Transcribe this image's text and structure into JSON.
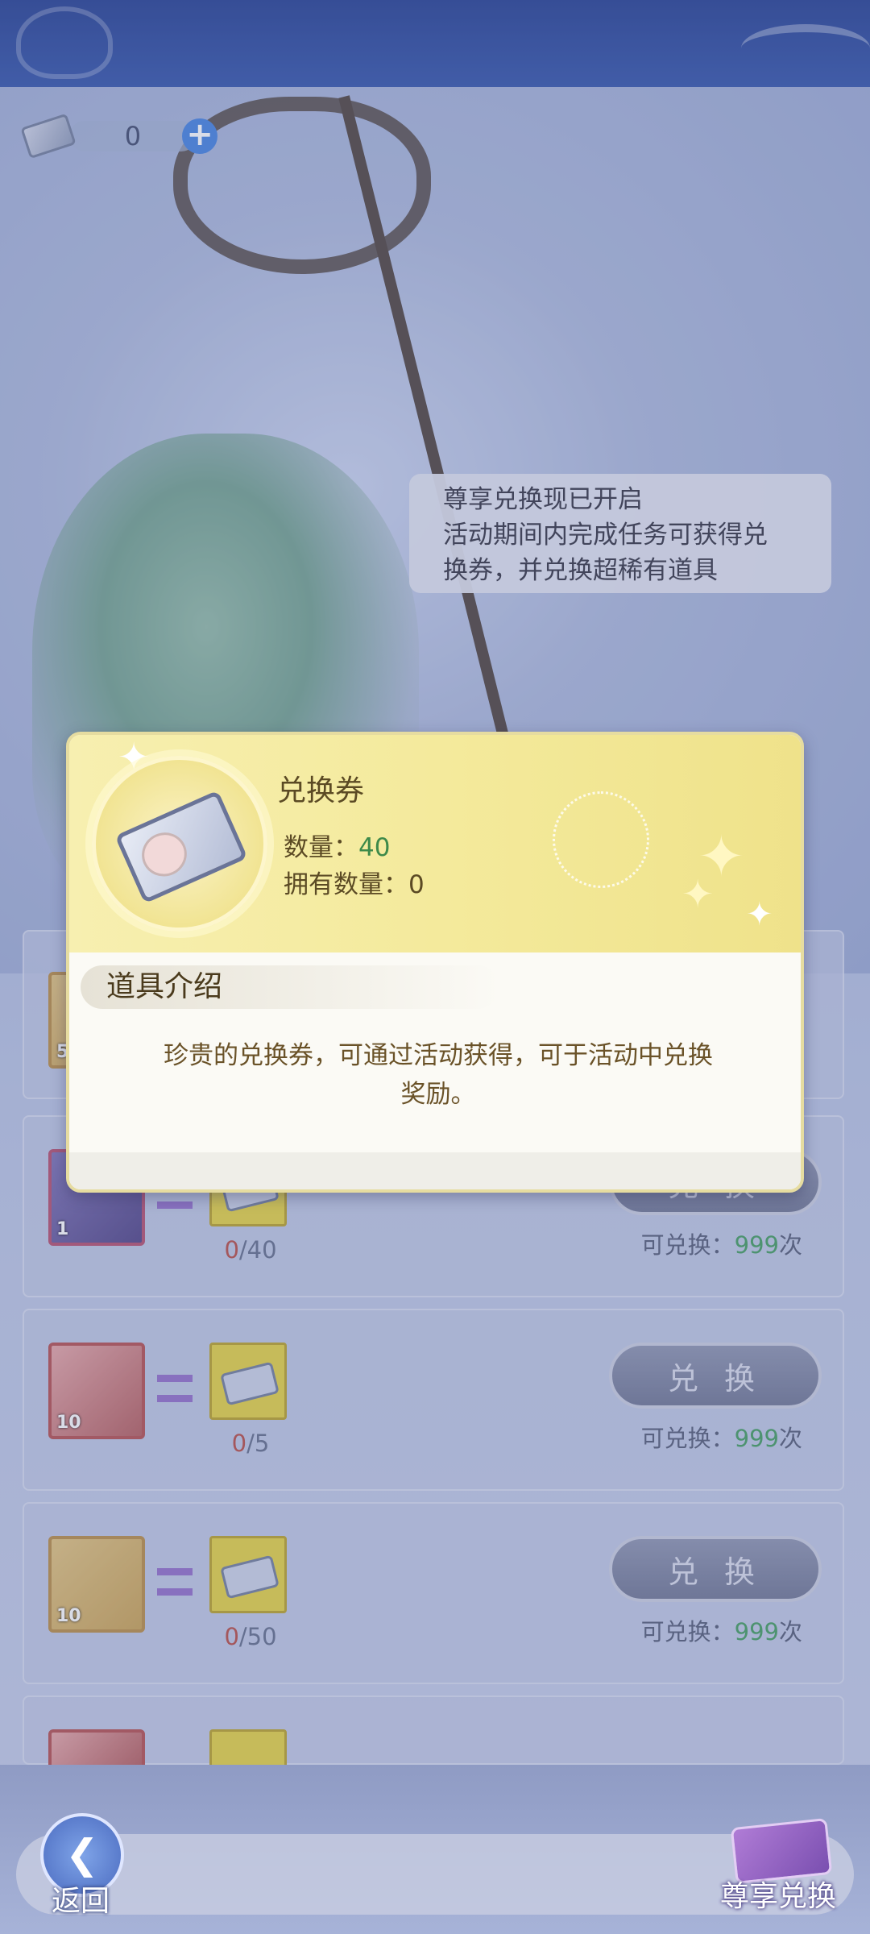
{
  "currency": {
    "count": "0",
    "plus": "+"
  },
  "bubble": {
    "line1": "尊享兑换现已开启",
    "line2": "活动期间内完成任务可获得兑",
    "line3": "换券，并兑换超稀有道具"
  },
  "rows": [
    {
      "reward_qty": "1",
      "progress_cur": "0",
      "progress_total": "/40",
      "button": "兑 换",
      "remain_label": "可兑换：",
      "remain_num": "999",
      "remain_unit": "次"
    },
    {
      "reward_qty": "10",
      "progress_cur": "0",
      "progress_total": "/5",
      "button": "兑 换",
      "remain_label": "可兑换：",
      "remain_num": "999",
      "remain_unit": "次"
    },
    {
      "reward_qty": "10",
      "progress_cur": "0",
      "progress_total": "/50",
      "button": "兑 换",
      "remain_label": "可兑换：",
      "remain_num": "999",
      "remain_unit": "次"
    }
  ],
  "partial_row": {
    "reward_qty": "5"
  },
  "modal": {
    "item_name": "兑换券",
    "quantity_label": "数量：",
    "quantity_value": "40",
    "owned_label": "拥有数量：",
    "owned_value": "0",
    "section_title": "道具介绍",
    "description_line1": "珍贵的兑换券，可通过活动获得，可于活动中兑换",
    "description_line2": "奖励。"
  },
  "bottom": {
    "back_label": "返回",
    "back_icon": "back-arrow-icon",
    "vip_label": "尊享兑换"
  },
  "colors": {
    "accent_green": "#3d8a4a",
    "progress_red": "#b6473f",
    "top_bar": "#1e3a8f"
  }
}
